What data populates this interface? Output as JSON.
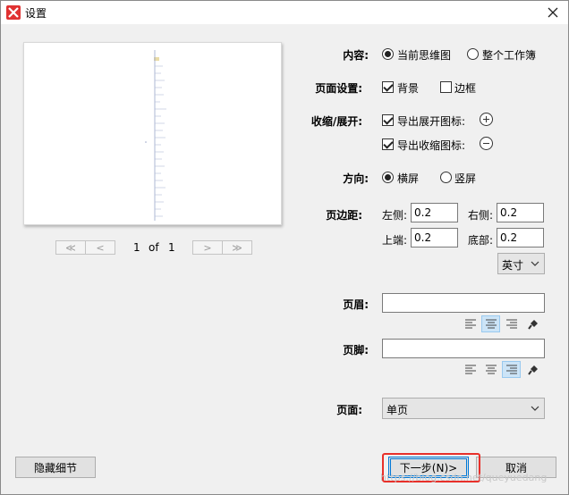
{
  "window": {
    "title": "设置"
  },
  "pager": {
    "first": "≪",
    "prev": "<",
    "page": "1",
    "of": "of",
    "total": "1",
    "next": ">",
    "last": "≫"
  },
  "content": {
    "label": "内容:",
    "options": [
      "当前思维图",
      "整个工作簿"
    ],
    "selected": 0
  },
  "page_setup": {
    "label": "页面设置:",
    "background": "背景",
    "background_checked": true,
    "border": "边框",
    "border_checked": false
  },
  "collapse": {
    "label": "收缩/展开:",
    "export_expand": "导出展开图标:",
    "export_collapse": "导出收缩图标:",
    "expand_checked": true,
    "collapse_checked": true
  },
  "orientation": {
    "label": "方向:",
    "options": [
      "横屏",
      "竖屏"
    ],
    "selected": 0
  },
  "margins": {
    "label": "页边距:",
    "left_label": "左侧:",
    "left_value": "0.2",
    "right_label": "右侧:",
    "right_value": "0.2",
    "top_label": "上端:",
    "top_value": "0.2",
    "bottom_label": "底部:",
    "bottom_value": "0.2",
    "unit": "英寸"
  },
  "header": {
    "label": "页眉:",
    "value": "",
    "alignment": "center"
  },
  "footer": {
    "label": "页脚:",
    "value": "",
    "alignment": "right"
  },
  "pages": {
    "label": "页面:",
    "value": "单页"
  },
  "buttons": {
    "hide_details": "隐藏细节",
    "next": "下一步(N)>",
    "cancel": "取消"
  },
  "watermark": "https://blog.csdn.net/queyuedang",
  "colors": {
    "accent": "#0078d7",
    "highlight": "#e8302a",
    "icon_red": "#e03131"
  }
}
